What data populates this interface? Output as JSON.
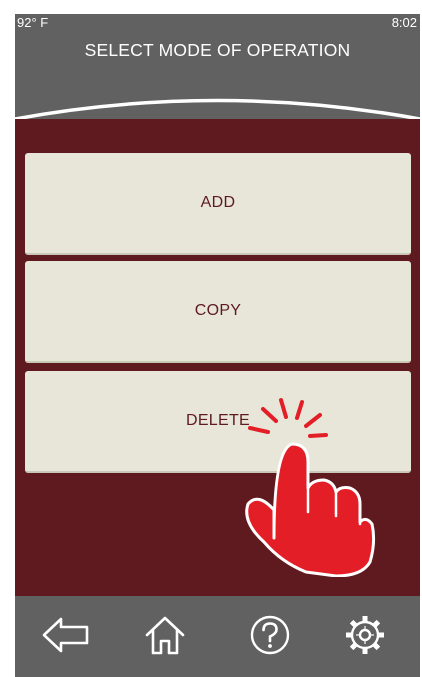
{
  "status": {
    "temperature": "92° F",
    "time": "8:02"
  },
  "header": {
    "title": "SELECT MODE OF OPERATION"
  },
  "modes": [
    {
      "label": "ADD"
    },
    {
      "label": "COPY"
    },
    {
      "label": "DELETE"
    }
  ],
  "footer": {
    "icons": [
      "back-arrow-icon",
      "home-icon",
      "help-icon",
      "settings-gear-icon"
    ]
  },
  "colors": {
    "header_bg": "#616161",
    "content_bg": "#5e1a1f",
    "button_bg": "#e7e6d8",
    "button_text": "#5e1a1f",
    "pointer_hand": "#e31e26"
  }
}
